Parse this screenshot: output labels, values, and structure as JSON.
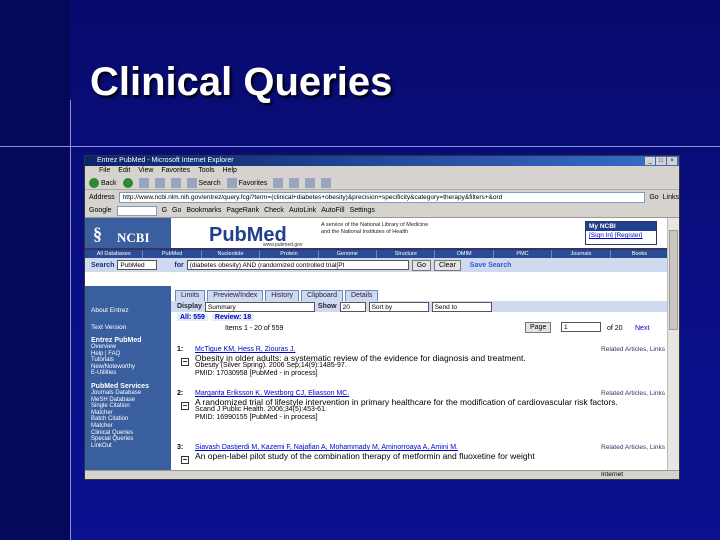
{
  "slide": {
    "title": "Clinical Queries"
  },
  "browser": {
    "title": "Entrez PubMed - Microsoft Internet Explorer",
    "menu": [
      "File",
      "Edit",
      "View",
      "Favorites",
      "Tools",
      "Help"
    ],
    "toolbar": {
      "back": "Back",
      "search": "Search",
      "favorites": "Favorites"
    },
    "address_label": "Address",
    "address": "http://www.ncbi.nlm.nih.gov/entrez/query.fcgi?term=(clinical+diabetes+obesity)&precision+specificity&category=therapy&filters+&ord",
    "go": "Go",
    "links": "Links",
    "google_label": "Google",
    "google_items": [
      "G",
      "Go",
      "Bookmarks",
      "PageRank",
      "Check",
      "AutoLink",
      "AutoFill",
      "Settings"
    ],
    "status_text": "",
    "zone": "Internet"
  },
  "ncbi": {
    "logo_text": "NCBI",
    "pubmed_logo": "PubMed",
    "pubmed_sub": "www.pubmed.gov",
    "nlm_line1": "A service of the National Library of Medicine",
    "nlm_line2": "and the National Institutes of Health",
    "my_ncbi": "My NCBI",
    "sign_in": "[Sign In]",
    "register": "[Register]",
    "nav": [
      "All Databases",
      "PubMed",
      "Nucleotide",
      "Protein",
      "Genome",
      "Structure",
      "OMIM",
      "PMC",
      "Journals",
      "Books"
    ],
    "search_label": "Search",
    "search_db": "PubMed",
    "for_label": "for",
    "query": "(diabetes obesity) AND (randomized controlled trial[Pt",
    "go_btn": "Go",
    "clear_btn": "Clear",
    "save_search": "Save Search"
  },
  "sidebar": {
    "about": "About Entrez",
    "text": "Text Version",
    "entrez_heading": "Entrez PubMed",
    "entrez_items": [
      "Overview",
      "Help | FAQ",
      "Tutorials",
      "New/Noteworthy",
      "E-Utilities"
    ],
    "services_heading": "PubMed Services",
    "services_items": [
      "Journals Database",
      "MeSH Database",
      "Single Citation",
      "Matcher",
      "Batch Citation",
      "Matcher",
      "Clinical Queries",
      "Special Queries",
      "LinkOut"
    ]
  },
  "tabs": [
    "Limits",
    "Preview/Index",
    "History",
    "Clipboard",
    "Details"
  ],
  "options": {
    "display_label": "Display",
    "display_val": "Summary",
    "show_label": "Show",
    "show_val": "20",
    "sort": "Sort by",
    "send": "Send to"
  },
  "counts": {
    "all": "All: 559",
    "review": "Review: 18"
  },
  "pager": {
    "items": "Items 1 - 20 of 559",
    "page_btn": "Page",
    "page_val": "1",
    "of": "of 20",
    "next": "Next"
  },
  "results": [
    {
      "num": "1:",
      "authors": "McTigue KM, Hess R, Ziouras J.",
      "title": "Obesity in older adults: a systematic review of the evidence for diagnosis and treatment.",
      "source": "Obesity (Silver Spring). 2006 Sep;14(9):1485-97.",
      "pmid": "PMID: 17030958 [PubMed - in process]",
      "related": "Related Articles, Links"
    },
    {
      "num": "2:",
      "authors": "Margarita Eriksson K, Westborg CJ, Eliasson MC.",
      "title": "A randomized trial of lifestyle intervention in primary healthcare for the modification of cardiovascular risk factors.",
      "source": "Scand J Public Health. 2006;34(5):453-61.",
      "pmid": "PMID: 16990155 [PubMed - in process]",
      "related": "Related Articles, Links"
    },
    {
      "num": "3:",
      "authors": "Siavash Dastjerdi M, Kazemi F, Najafian A, Mohammady M, Aminorroaya A, Amini M.",
      "title": "An open-label pilot study of the combination therapy of metformin and fluoxetine for weight",
      "source": "",
      "pmid": "",
      "related": "Related Articles, Links"
    }
  ]
}
